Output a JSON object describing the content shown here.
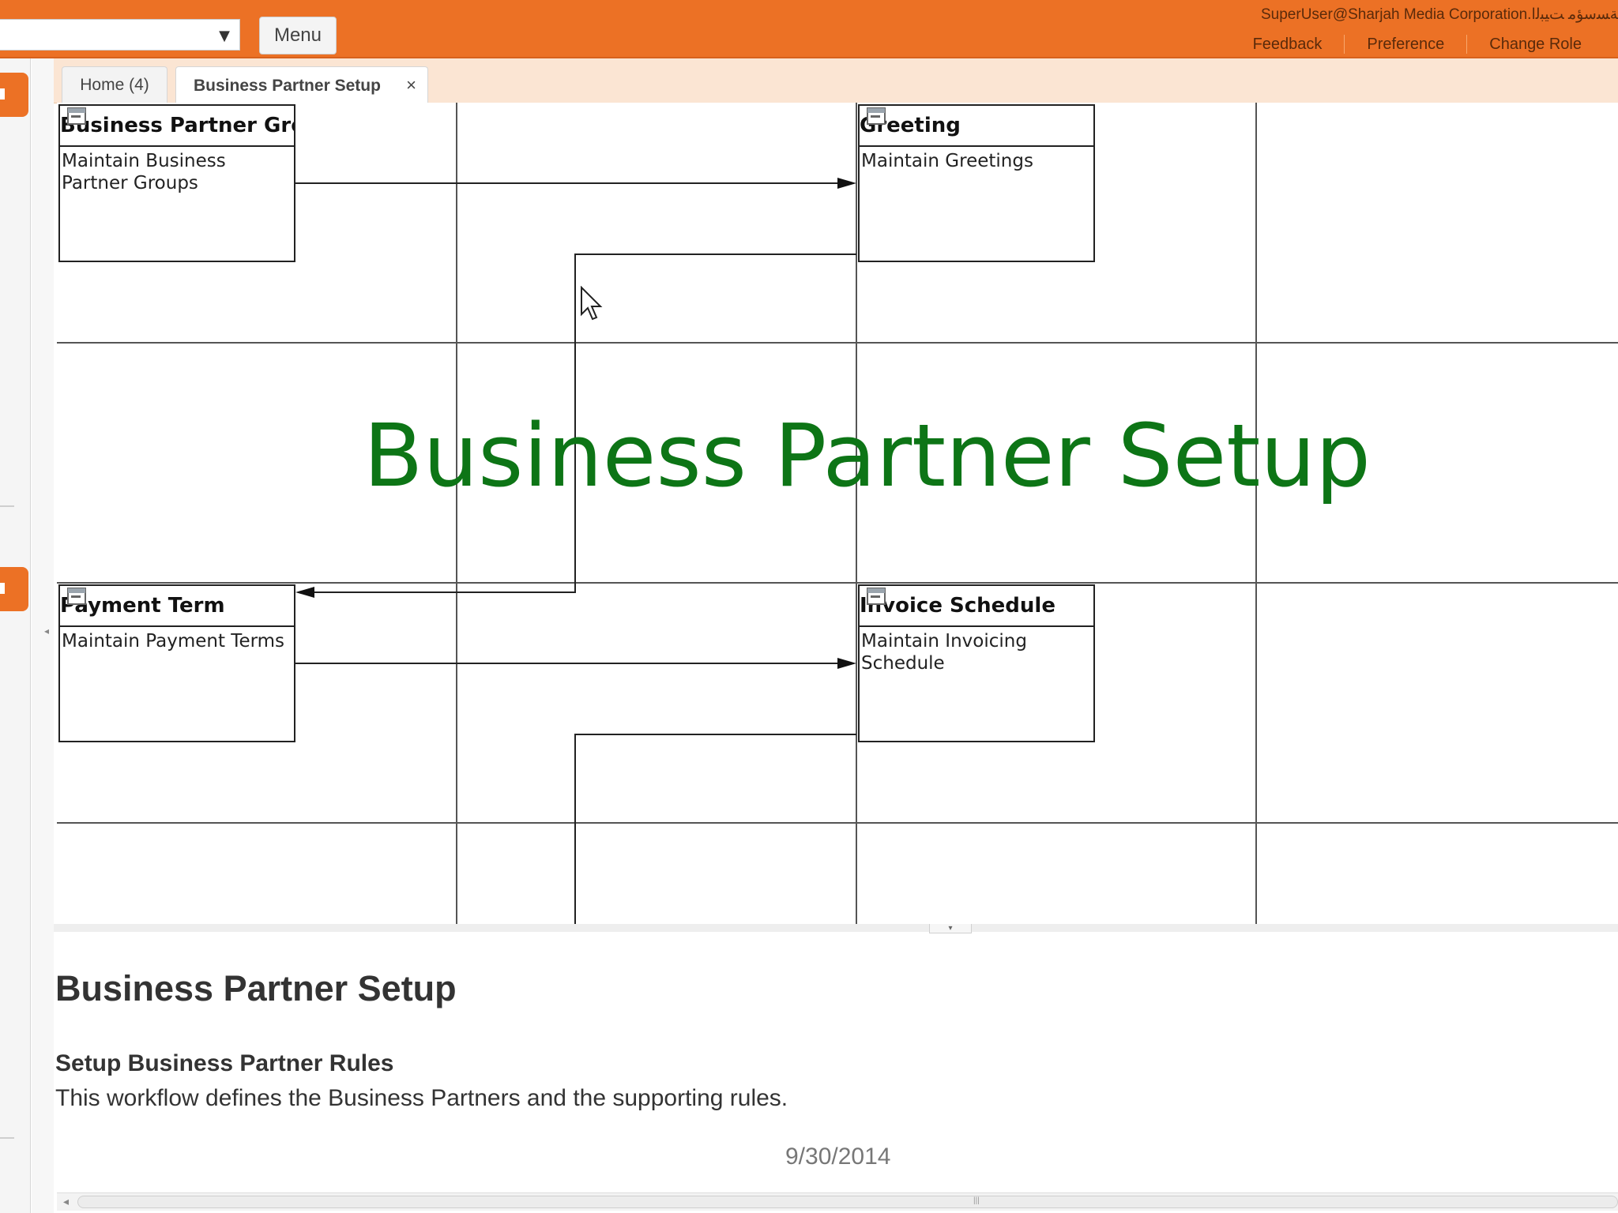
{
  "header": {
    "menu_button": "Menu",
    "user_info": "SuperUser@Sharjah Media Corporation.ﺔﺴﺳﺆﻣ ﺖﻴﺒﻟﺍ",
    "links": [
      "Feedback",
      "Preference",
      "Change Role"
    ]
  },
  "tabs": [
    {
      "label": "Home (4)"
    },
    {
      "label": "Business Partner Setup",
      "close": "×"
    }
  ],
  "workflow": {
    "nodes": [
      {
        "title": "Business Partner Group",
        "description": "Maintain Business Partner Groups"
      },
      {
        "title": "Greeting",
        "description": "Maintain Greetings"
      },
      {
        "title": "Payment Term",
        "description": "Maintain Payment Terms"
      },
      {
        "title": "Invoice Schedule",
        "description": "Maintain Invoicing Schedule"
      }
    ],
    "overlay_title": "Business Partner Setup"
  },
  "detail": {
    "title": "Business Partner Setup",
    "subtitle": "Setup Business Partner Rules",
    "description": "This workflow defines the Business Partners and the supporting rules."
  },
  "slide_date": "9/30/2014",
  "icons": {
    "combo": "chevron-down-icon",
    "node": "window-icon",
    "cursor": "mouse-pointer-icon",
    "close": "close-icon"
  },
  "colors": {
    "header": "#ec7125",
    "tab_strip": "#fbe5d3",
    "overlay_title": "#0d7516"
  }
}
